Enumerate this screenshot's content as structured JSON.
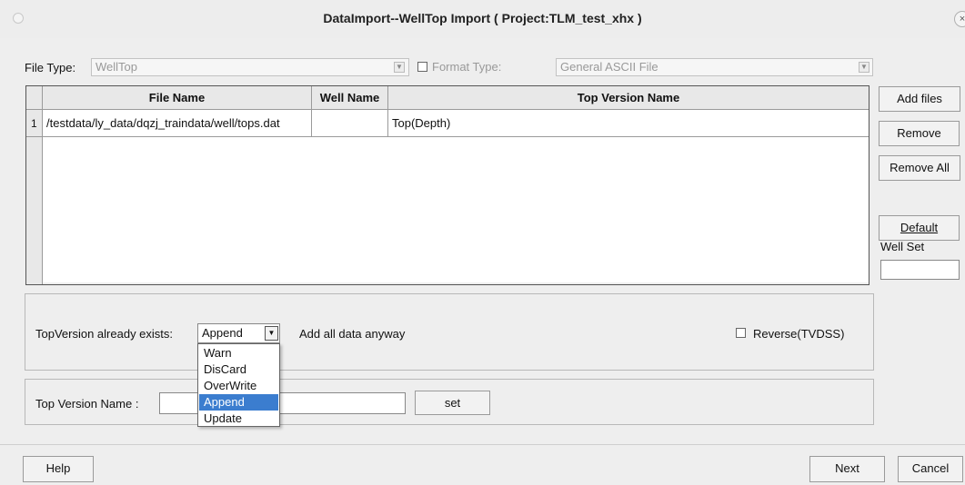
{
  "window": {
    "title": "DataImport--WellTop Import ( Project:TLM_test_xhx )",
    "close_glyph": "×"
  },
  "file_type": {
    "label": "File Type:",
    "value": "WellTop"
  },
  "format_type": {
    "label": "Format Type:",
    "value": "General ASCII File",
    "checked": false
  },
  "table": {
    "columns": [
      "File Name",
      "Well Name",
      "Top Version Name"
    ],
    "rows": [
      {
        "index": "1",
        "file_name": "/testdata/ly_data/dqzj_traindata/well/tops.dat",
        "well_name": "",
        "top_version_name": "Top(Depth)"
      }
    ]
  },
  "side_buttons": {
    "add_files": "Add files",
    "remove": "Remove",
    "remove_all": "Remove All",
    "default": "Default"
  },
  "well_set": {
    "label": "Well Set",
    "value": ""
  },
  "top_version_exists": {
    "label": "TopVersion already exists:",
    "selected": "Append",
    "hint": "Add all data anyway",
    "options": [
      "Warn",
      "DisCard",
      "OverWrite",
      "Append",
      "Update"
    ],
    "highlighted_option": "Append"
  },
  "reverse": {
    "label": "Reverse(TVDSS)",
    "checked": false
  },
  "top_version_name": {
    "label": "Top Version Name :",
    "value": "",
    "set_button": "set"
  },
  "footer": {
    "help": "Help",
    "next": "Next",
    "cancel": "Cancel"
  },
  "colors": {
    "selection": "#3b7dcf",
    "background": "#eeeeee"
  },
  "icons": {
    "combo_arrow": "chevron-down-icon",
    "close": "close-icon"
  }
}
